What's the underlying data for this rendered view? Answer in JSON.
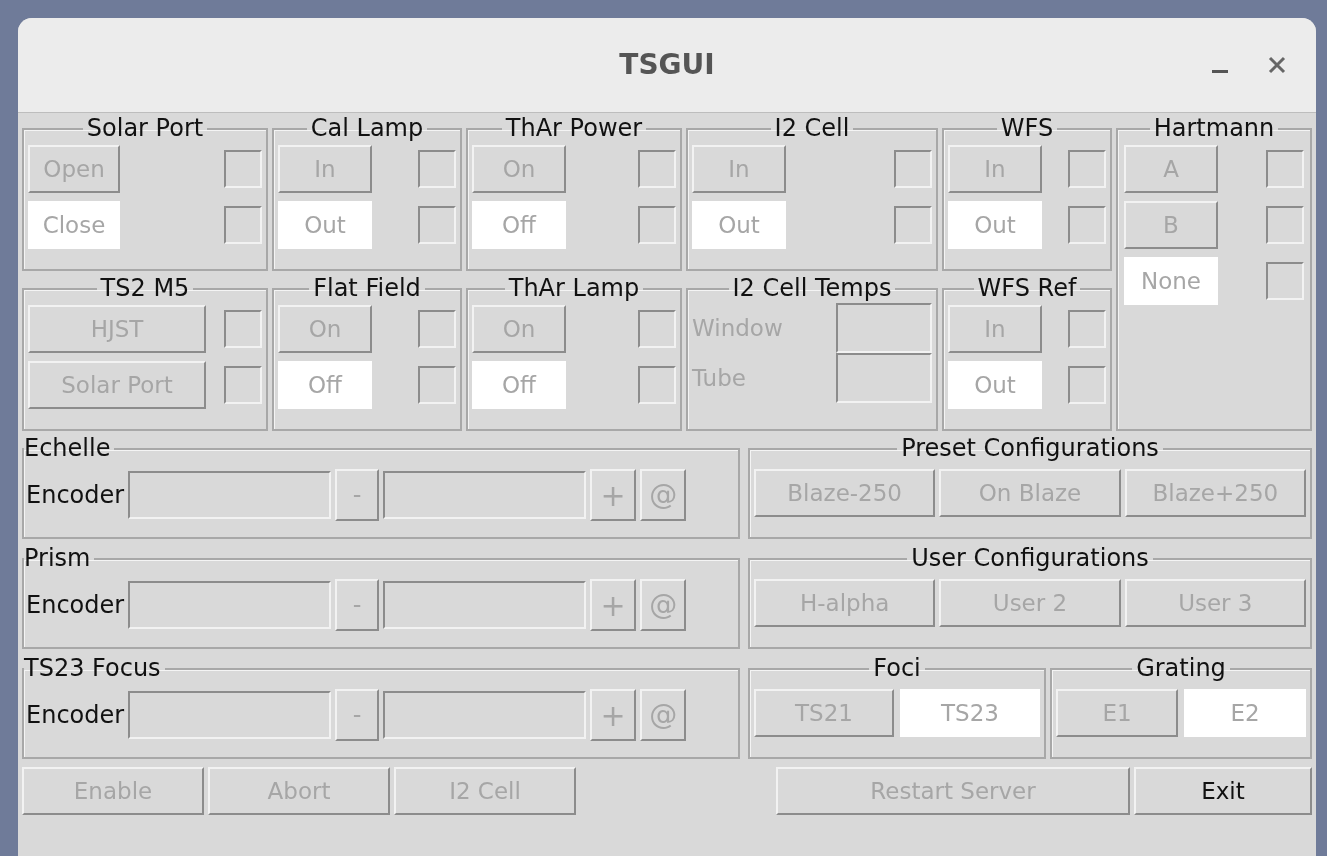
{
  "window": {
    "title": "TSGUI"
  },
  "toggle_rows": [
    [
      {
        "kind": "toggle",
        "title": "Solar Port",
        "options": [
          {
            "label": "Open",
            "selected": false,
            "disabled": true,
            "lit": false
          },
          {
            "label": "Close",
            "selected": true,
            "disabled": true,
            "lit": false
          }
        ]
      },
      {
        "kind": "toggle",
        "title": "Cal Lamp",
        "options": [
          {
            "label": "In",
            "selected": false,
            "disabled": true,
            "lit": false
          },
          {
            "label": "Out",
            "selected": true,
            "disabled": true,
            "lit": false
          }
        ]
      },
      {
        "kind": "toggle",
        "title": "ThAr Power",
        "options": [
          {
            "label": "On",
            "selected": false,
            "disabled": true,
            "lit": false
          },
          {
            "label": "Off",
            "selected": true,
            "disabled": true,
            "lit": false
          }
        ]
      },
      {
        "kind": "toggle",
        "title": "I2 Cell",
        "options": [
          {
            "label": "In",
            "selected": false,
            "disabled": true,
            "lit": false
          },
          {
            "label": "Out",
            "selected": true,
            "disabled": true,
            "lit": false
          }
        ]
      },
      {
        "kind": "toggle",
        "title": "WFS",
        "options": [
          {
            "label": "In",
            "selected": false,
            "disabled": true,
            "lit": false
          },
          {
            "label": "Out",
            "selected": true,
            "disabled": true,
            "lit": false
          }
        ]
      }
    ],
    [
      {
        "kind": "toggle",
        "title": "TS2 M5",
        "options": [
          {
            "label": "HJST",
            "selected": false,
            "disabled": true,
            "lit": false
          },
          {
            "label": "Solar Port",
            "selected": false,
            "disabled": true,
            "lit": false
          }
        ]
      },
      {
        "kind": "toggle",
        "title": "Flat Field",
        "options": [
          {
            "label": "On",
            "selected": false,
            "disabled": true,
            "lit": false
          },
          {
            "label": "Off",
            "selected": true,
            "disabled": true,
            "lit": false
          }
        ]
      },
      {
        "kind": "toggle",
        "title": "ThAr Lamp",
        "options": [
          {
            "label": "On",
            "selected": false,
            "disabled": true,
            "lit": false
          },
          {
            "label": "Off",
            "selected": true,
            "disabled": true,
            "lit": false
          }
        ]
      },
      {
        "kind": "readout",
        "title": "I2 Cell Temps",
        "fields": [
          {
            "label": "Window"
          },
          {
            "label": "Tube"
          }
        ]
      },
      {
        "kind": "toggle",
        "title": "WFS Ref",
        "options": [
          {
            "label": "In",
            "selected": false,
            "disabled": true,
            "lit": false
          },
          {
            "label": "Out",
            "selected": true,
            "disabled": true,
            "lit": false
          }
        ]
      }
    ]
  ],
  "hartmann": {
    "title": "Hartmann",
    "options": [
      {
        "label": "A",
        "selected": false,
        "disabled": true,
        "lit": false
      },
      {
        "label": "B",
        "selected": false,
        "disabled": true,
        "lit": false
      },
      {
        "label": "None",
        "selected": true,
        "disabled": true,
        "lit": false
      }
    ]
  },
  "encoders": [
    {
      "title": "Echelle",
      "label": "Encoder",
      "minus": "-",
      "plus": "+",
      "go": "@",
      "disabled": true
    },
    {
      "title": "Prism",
      "label": "Encoder",
      "minus": "-",
      "plus": "+",
      "go": "@",
      "disabled": true
    },
    {
      "title": "TS23 Focus",
      "label": "Encoder",
      "minus": "-",
      "plus": "+",
      "go": "@",
      "disabled": true
    }
  ],
  "preset_configurations": {
    "title": "Preset Configurations",
    "buttons": [
      {
        "label": "Blaze-250",
        "disabled": true
      },
      {
        "label": "On Blaze",
        "disabled": true
      },
      {
        "label": "Blaze+250",
        "disabled": true
      }
    ]
  },
  "user_configurations": {
    "title": "User Configurations",
    "buttons": [
      {
        "label": "H-alpha",
        "disabled": true
      },
      {
        "label": "User 2",
        "disabled": true
      },
      {
        "label": "User 3",
        "disabled": true
      }
    ]
  },
  "foci": {
    "title": "Foci",
    "options": [
      {
        "label": "TS21",
        "selected": false,
        "disabled": true
      },
      {
        "label": "TS23",
        "selected": true,
        "disabled": true
      }
    ]
  },
  "grating": {
    "title": "Grating",
    "options": [
      {
        "label": "E1",
        "selected": false,
        "disabled": true
      },
      {
        "label": "E2",
        "selected": true,
        "disabled": true
      }
    ]
  },
  "bottom_left": [
    {
      "label": "Enable",
      "disabled": true
    },
    {
      "label": "Abort",
      "disabled": true
    },
    {
      "label": "I2 Cell",
      "disabled": true
    }
  ],
  "bottom_right": [
    {
      "label": "Restart Server",
      "disabled": true
    },
    {
      "label": "Exit",
      "disabled": false
    }
  ]
}
